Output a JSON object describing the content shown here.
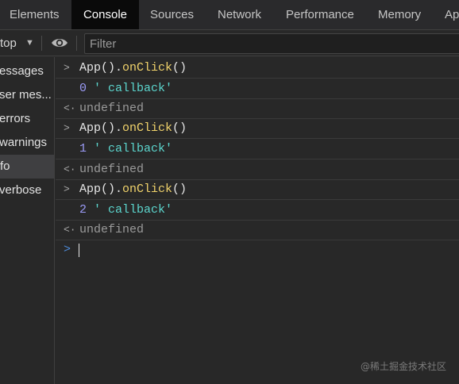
{
  "tabs": [
    {
      "label": "Elements",
      "active": false
    },
    {
      "label": "Console",
      "active": true
    },
    {
      "label": "Sources",
      "active": false
    },
    {
      "label": "Network",
      "active": false
    },
    {
      "label": "Performance",
      "active": false
    },
    {
      "label": "Memory",
      "active": false
    },
    {
      "label": "Ap",
      "active": false
    }
  ],
  "toolbar": {
    "context": "top",
    "context_arrow": "▼",
    "eye_icon": "eye-icon",
    "filter_placeholder": "Filter"
  },
  "sidebar": {
    "items": [
      {
        "label": "essages",
        "selected": false
      },
      {
        "label": "ser mes...",
        "selected": false
      },
      {
        "label": "errors",
        "selected": false
      },
      {
        "label": "warnings",
        "selected": false
      },
      {
        "label": "fo",
        "selected": true
      },
      {
        "label": "verbose",
        "selected": false
      }
    ]
  },
  "console": {
    "entries": [
      {
        "kind": "input",
        "gutter": ">",
        "obj": "App().",
        "method": "onClick",
        "parens": "()"
      },
      {
        "kind": "log",
        "num": "0",
        "str": " ' callback'"
      },
      {
        "kind": "result",
        "gutter": "<·",
        "text": "undefined"
      },
      {
        "kind": "input",
        "gutter": ">",
        "obj": "App().",
        "method": "onClick",
        "parens": "()"
      },
      {
        "kind": "log",
        "num": "1",
        "str": " ' callback'"
      },
      {
        "kind": "result",
        "gutter": "<·",
        "text": "undefined"
      },
      {
        "kind": "input",
        "gutter": ">",
        "obj": "App().",
        "method": "onClick",
        "parens": "()"
      },
      {
        "kind": "log",
        "num": "2",
        "str": " ' callback'"
      },
      {
        "kind": "result",
        "gutter": "<·",
        "text": "undefined"
      }
    ],
    "prompt": ">"
  },
  "watermark": "@稀土掘金技术社区",
  "colors": {
    "active_tab_bg": "#0a0a0a",
    "panel_bg": "#282828",
    "method": "#f1d36b",
    "number": "#9b9bf7",
    "string": "#5cd6ce",
    "undefined": "#9a9a9a",
    "prompt": "#4d8ad8"
  }
}
